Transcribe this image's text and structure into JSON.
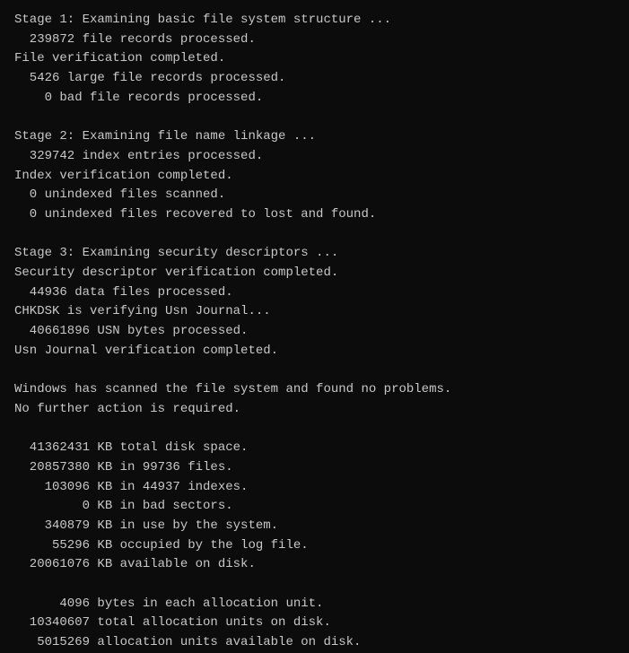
{
  "terminal": {
    "lines": [
      "Stage 1: Examining basic file system structure ...",
      "  239872 file records processed.",
      "File verification completed.",
      "  5426 large file records processed.",
      "    0 bad file records processed.",
      "",
      "Stage 2: Examining file name linkage ...",
      "  329742 index entries processed.",
      "Index verification completed.",
      "  0 unindexed files scanned.",
      "  0 unindexed files recovered to lost and found.",
      "",
      "Stage 3: Examining security descriptors ...",
      "Security descriptor verification completed.",
      "  44936 data files processed.",
      "CHKDSK is verifying Usn Journal...",
      "  40661896 USN bytes processed.",
      "Usn Journal verification completed.",
      "",
      "Windows has scanned the file system and found no problems.",
      "No further action is required.",
      "",
      "  41362431 KB total disk space.",
      "  20857380 KB in 99736 files.",
      "    103096 KB in 44937 indexes.",
      "         0 KB in bad sectors.",
      "    340879 KB in use by the system.",
      "     55296 KB occupied by the log file.",
      "  20061076 KB available on disk.",
      "",
      "      4096 bytes in each allocation unit.",
      "  10340607 total allocation units on disk.",
      "   5015269 allocation units available on disk."
    ]
  }
}
